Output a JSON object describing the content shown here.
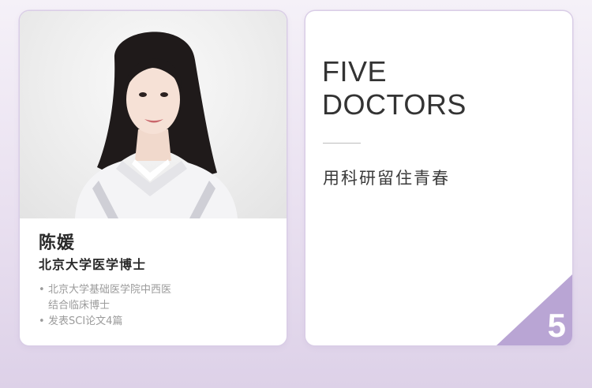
{
  "doctor_card": {
    "photo": {
      "icon": "doctor-portrait"
    },
    "name": "陈媛",
    "title": "北京大学医学博士",
    "bullet": "•",
    "credentials": [
      {
        "lines": [
          "北京大学基础医学院中西医",
          "结合临床博士"
        ]
      },
      {
        "lines": [
          "发表SCI论文4篇"
        ]
      }
    ]
  },
  "intro_card": {
    "heading_line1": "FIVE",
    "heading_line2": "DOCTORS",
    "slogan": "用科研留住青春",
    "number": "5",
    "accent_color": "#b9a5d4"
  }
}
